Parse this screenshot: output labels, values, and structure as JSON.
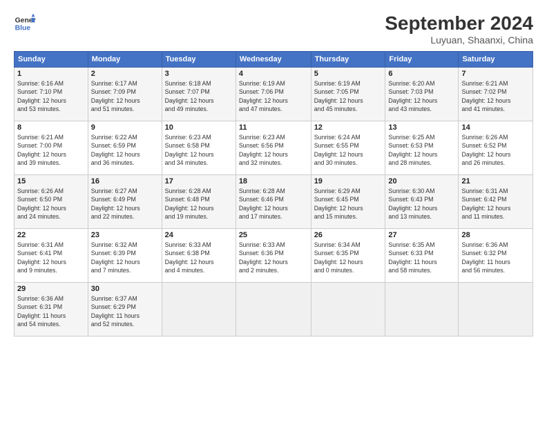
{
  "logo": {
    "line1": "General",
    "line2": "Blue"
  },
  "header": {
    "month": "September 2024",
    "location": "Luyuan, Shaanxi, China"
  },
  "weekdays": [
    "Sunday",
    "Monday",
    "Tuesday",
    "Wednesday",
    "Thursday",
    "Friday",
    "Saturday"
  ],
  "weeks": [
    [
      {
        "day": "1",
        "rise": "6:16 AM",
        "set": "7:10 PM",
        "hours": "12 hours",
        "mins": "53"
      },
      {
        "day": "2",
        "rise": "6:17 AM",
        "set": "7:09 PM",
        "hours": "12 hours",
        "mins": "51"
      },
      {
        "day": "3",
        "rise": "6:18 AM",
        "set": "7:07 PM",
        "hours": "12 hours",
        "mins": "49"
      },
      {
        "day": "4",
        "rise": "6:19 AM",
        "set": "7:06 PM",
        "hours": "12 hours",
        "mins": "47"
      },
      {
        "day": "5",
        "rise": "6:19 AM",
        "set": "7:05 PM",
        "hours": "12 hours",
        "mins": "45"
      },
      {
        "day": "6",
        "rise": "6:20 AM",
        "set": "7:03 PM",
        "hours": "12 hours",
        "mins": "43"
      },
      {
        "day": "7",
        "rise": "6:21 AM",
        "set": "7:02 PM",
        "hours": "12 hours",
        "mins": "41"
      }
    ],
    [
      {
        "day": "8",
        "rise": "6:21 AM",
        "set": "7:00 PM",
        "hours": "12 hours",
        "mins": "39"
      },
      {
        "day": "9",
        "rise": "6:22 AM",
        "set": "6:59 PM",
        "hours": "12 hours",
        "mins": "36"
      },
      {
        "day": "10",
        "rise": "6:23 AM",
        "set": "6:58 PM",
        "hours": "12 hours",
        "mins": "34"
      },
      {
        "day": "11",
        "rise": "6:23 AM",
        "set": "6:56 PM",
        "hours": "12 hours",
        "mins": "32"
      },
      {
        "day": "12",
        "rise": "6:24 AM",
        "set": "6:55 PM",
        "hours": "12 hours",
        "mins": "30"
      },
      {
        "day": "13",
        "rise": "6:25 AM",
        "set": "6:53 PM",
        "hours": "12 hours",
        "mins": "28"
      },
      {
        "day": "14",
        "rise": "6:26 AM",
        "set": "6:52 PM",
        "hours": "12 hours",
        "mins": "26"
      }
    ],
    [
      {
        "day": "15",
        "rise": "6:26 AM",
        "set": "6:50 PM",
        "hours": "12 hours",
        "mins": "24"
      },
      {
        "day": "16",
        "rise": "6:27 AM",
        "set": "6:49 PM",
        "hours": "12 hours",
        "mins": "22"
      },
      {
        "day": "17",
        "rise": "6:28 AM",
        "set": "6:48 PM",
        "hours": "12 hours",
        "mins": "19"
      },
      {
        "day": "18",
        "rise": "6:28 AM",
        "set": "6:46 PM",
        "hours": "12 hours",
        "mins": "17"
      },
      {
        "day": "19",
        "rise": "6:29 AM",
        "set": "6:45 PM",
        "hours": "12 hours",
        "mins": "15"
      },
      {
        "day": "20",
        "rise": "6:30 AM",
        "set": "6:43 PM",
        "hours": "12 hours",
        "mins": "13"
      },
      {
        "day": "21",
        "rise": "6:31 AM",
        "set": "6:42 PM",
        "hours": "12 hours",
        "mins": "11"
      }
    ],
    [
      {
        "day": "22",
        "rise": "6:31 AM",
        "set": "6:41 PM",
        "hours": "12 hours",
        "mins": "9"
      },
      {
        "day": "23",
        "rise": "6:32 AM",
        "set": "6:39 PM",
        "hours": "12 hours",
        "mins": "7"
      },
      {
        "day": "24",
        "rise": "6:33 AM",
        "set": "6:38 PM",
        "hours": "12 hours",
        "mins": "4"
      },
      {
        "day": "25",
        "rise": "6:33 AM",
        "set": "6:36 PM",
        "hours": "12 hours",
        "mins": "2"
      },
      {
        "day": "26",
        "rise": "6:34 AM",
        "set": "6:35 PM",
        "hours": "12 hours",
        "mins": "0"
      },
      {
        "day": "27",
        "rise": "6:35 AM",
        "set": "6:33 PM",
        "hours": "11 hours",
        "mins": "58"
      },
      {
        "day": "28",
        "rise": "6:36 AM",
        "set": "6:32 PM",
        "hours": "11 hours",
        "mins": "56"
      }
    ],
    [
      {
        "day": "29",
        "rise": "6:36 AM",
        "set": "6:31 PM",
        "hours": "11 hours",
        "mins": "54"
      },
      {
        "day": "30",
        "rise": "6:37 AM",
        "set": "6:29 PM",
        "hours": "11 hours",
        "mins": "52"
      },
      null,
      null,
      null,
      null,
      null
    ]
  ]
}
